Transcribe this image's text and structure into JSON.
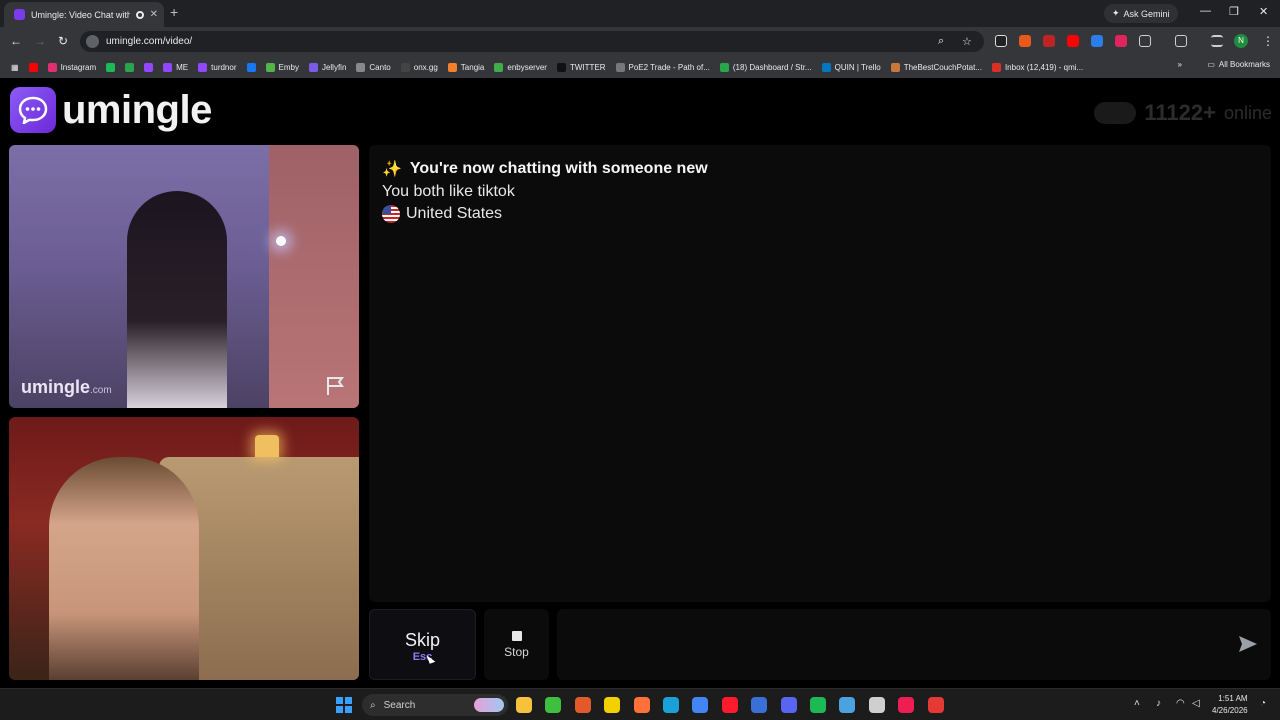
{
  "browser": {
    "tab_title": "Umingle: Video Chat with S",
    "url": "umingle.com/video/",
    "ask_gemini": "Ask Gemini",
    "profile_initial": "N",
    "all_bookmarks": "All Bookmarks",
    "bookmarks": [
      {
        "label": "",
        "color": "#ff0000"
      },
      {
        "label": "Instagram",
        "color": "#e1306c"
      },
      {
        "label": "",
        "color": "#1db954"
      },
      {
        "label": "",
        "color": "#2aa64a"
      },
      {
        "label": "",
        "color": "#9146ff"
      },
      {
        "label": "ME",
        "color": "#9146ff"
      },
      {
        "label": "turdnor",
        "color": "#9146ff"
      },
      {
        "label": "",
        "color": "#1877f2"
      },
      {
        "label": "Emby",
        "color": "#52b54b"
      },
      {
        "label": "Jellyfin",
        "color": "#7b5ce6"
      },
      {
        "label": "Canto",
        "color": "#888888"
      },
      {
        "label": "onx.gg",
        "color": "#444444"
      },
      {
        "label": "Tangia",
        "color": "#f4802a"
      },
      {
        "label": "enbyserver",
        "color": "#3fae49"
      },
      {
        "label": "TWITTER",
        "color": "#111111"
      },
      {
        "label": "PoE2 Trade - Path of...",
        "color": "#777777"
      },
      {
        "label": "(18) Dashboard / Str...",
        "color": "#2aa64a"
      },
      {
        "label": "QUIN | Trello",
        "color": "#0079bf"
      },
      {
        "label": "TheBestCouchPotat...",
        "color": "#c8783a"
      },
      {
        "label": "Inbox (12,419) - qmi...",
        "color": "#d93025"
      }
    ]
  },
  "site": {
    "logo_text": "umingle",
    "online_count": "11122+",
    "online_label": "online",
    "remote_watermark": "umingle",
    "remote_watermark_suffix": ".com"
  },
  "chat": {
    "sparkle": "✨",
    "headline": "You're now chatting with someone new",
    "interest": "You both like tiktok",
    "country": "United States"
  },
  "controls": {
    "skip_label": "Skip",
    "skip_hint": "Esc",
    "stop_label": "Stop",
    "message_value": ""
  },
  "taskbar": {
    "search_label": "Search",
    "time": "1:51 AM",
    "date": "4/26/2026",
    "apps": [
      {
        "name": "file-explorer",
        "color": "#f6c23e"
      },
      {
        "name": "media-player",
        "color": "#3fbf3f"
      },
      {
        "name": "app-orange",
        "color": "#e35a2a"
      },
      {
        "name": "sticky-notes",
        "color": "#f5d000"
      },
      {
        "name": "firefox",
        "color": "#ff7139"
      },
      {
        "name": "edge",
        "color": "#1aa2d8"
      },
      {
        "name": "chrome",
        "color": "#4285f4"
      },
      {
        "name": "opera",
        "color": "#ff1b2d"
      },
      {
        "name": "app-blue",
        "color": "#3b6fd8"
      },
      {
        "name": "discord",
        "color": "#5865f2"
      },
      {
        "name": "spotify",
        "color": "#1db954"
      },
      {
        "name": "notepad",
        "color": "#4aa3df"
      },
      {
        "name": "obs",
        "color": "#cfcfcf"
      },
      {
        "name": "tiktok",
        "color": "#ee1d52"
      },
      {
        "name": "app-red",
        "color": "#e53935"
      }
    ]
  }
}
